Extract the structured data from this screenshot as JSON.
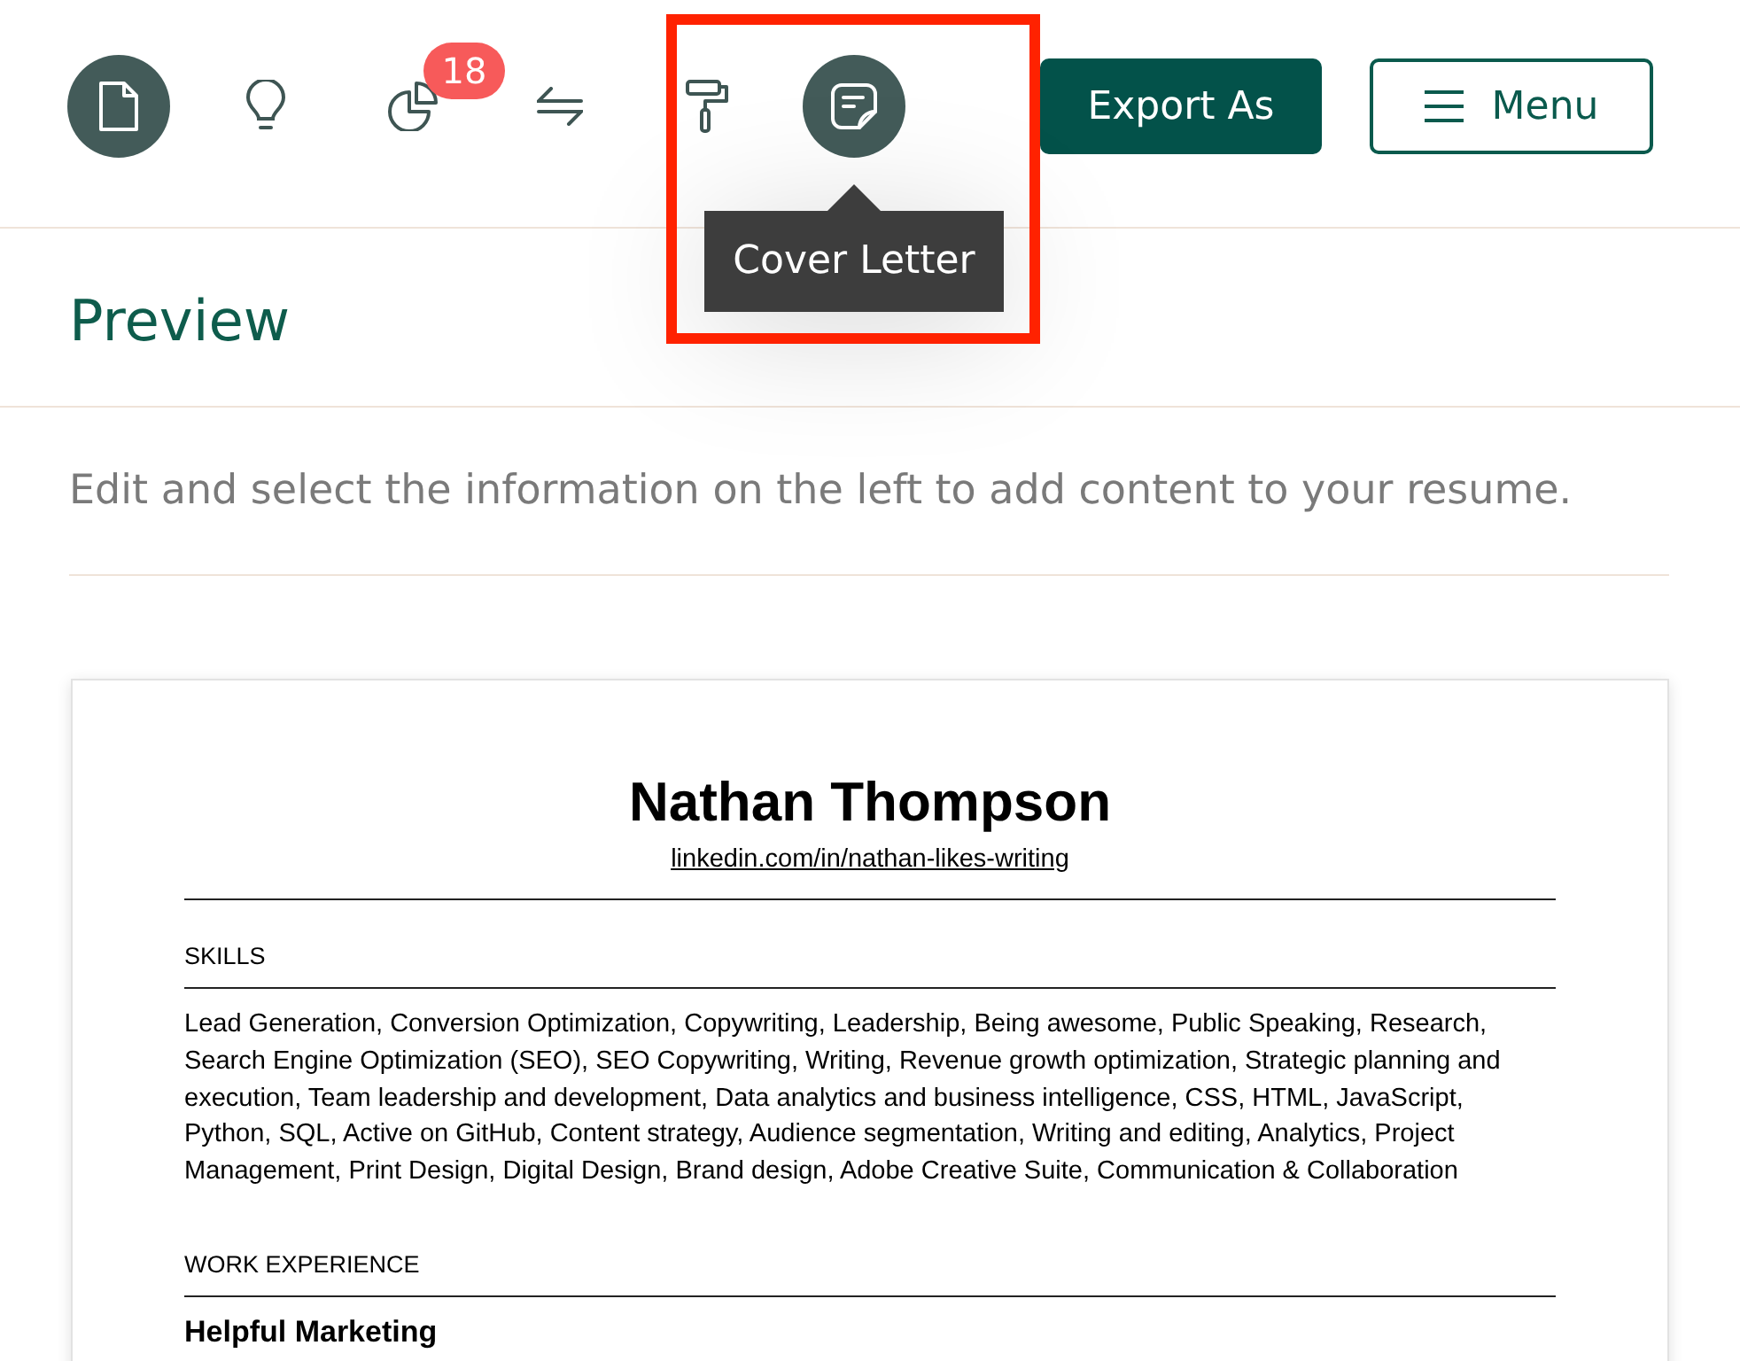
{
  "toolbar": {
    "tools": [
      {
        "selected": true,
        "highlighted": false
      },
      {
        "selected": false,
        "highlighted": false
      },
      {
        "selected": false,
        "highlighted": false,
        "badge": "18"
      },
      {
        "selected": false,
        "highlighted": false
      },
      {
        "selected": false,
        "highlighted": false
      },
      {
        "selected": true,
        "highlighted": true,
        "tooltip": "Cover Letter"
      }
    ],
    "buttons": [
      {
        "label": "Export As",
        "kind": "primary"
      },
      {
        "label": "Menu",
        "kind": "menu"
      }
    ]
  },
  "preview": {
    "title": "Preview",
    "hint": "Edit and select the information on the left to add content to your resume."
  },
  "resume": {
    "name": "Nathan Thompson",
    "link": "linkedin.com/in/nathan-likes-writing",
    "sections": [
      {
        "kind": "paragraph",
        "heading": "SKILLS",
        "text": "Lead Generation, Conversion Optimization, Copywriting, Leadership, Being awesome, Public Speaking, Research, Search Engine Optimization (SEO), SEO Copywriting, Writing, Revenue growth optimization, Strategic planning and execution, Team leadership and development, Data analytics and business intelligence, CSS, HTML, JavaScript, Python, SQL, Active on GitHub, Content strategy, Audience segmentation, Writing and editing, Analytics, Project Management, Print Design, Digital Design, Brand design, Adobe Creative Suite, Communication & Collaboration"
      },
      {
        "kind": "entries",
        "heading": "WORK EXPERIENCE",
        "entries": [
          {
            "company": "Helpful Marketing"
          }
        ]
      }
    ]
  }
}
